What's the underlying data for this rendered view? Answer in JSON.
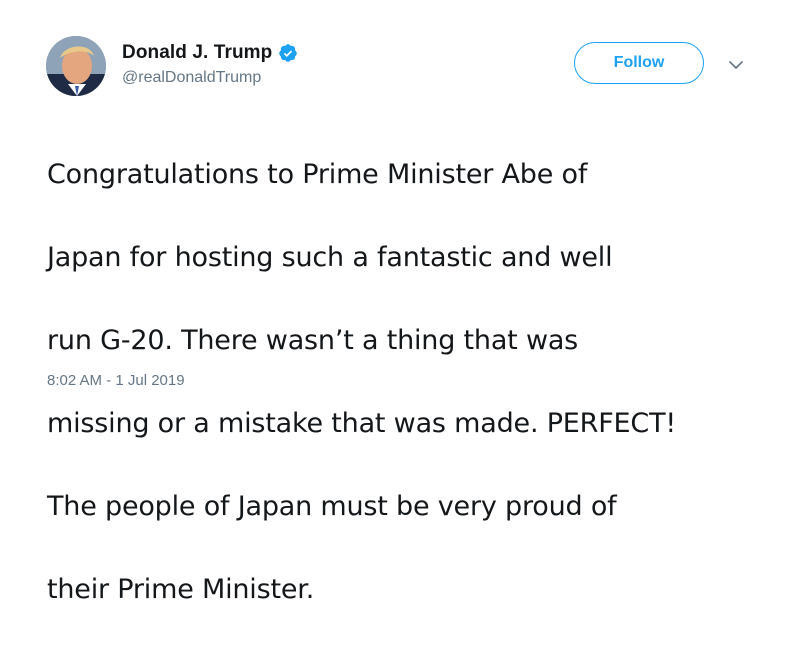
{
  "author": {
    "display_name": "Donald J. Trump",
    "handle": "@realDonaldTrump",
    "verified": true,
    "verified_icon": "verified-badge-icon",
    "avatar_icon": "profile-photo"
  },
  "actions": {
    "follow_label": "Follow",
    "menu_icon": "chevron-down-icon"
  },
  "tweet": {
    "lines": [
      "Congratulations to Prime Minister Abe of",
      "Japan for hosting such a fantastic and well",
      "run G-20. There wasn’t a thing that was",
      "missing or a mistake that was made. PERFECT!",
      "The people of Japan must be very proud of",
      "their Prime Minister."
    ],
    "timestamp": "8:02 AM - 1 Jul 2019"
  },
  "colors": {
    "accent": "#1da1f2",
    "text": "#14171a",
    "secondary": "#657786"
  }
}
